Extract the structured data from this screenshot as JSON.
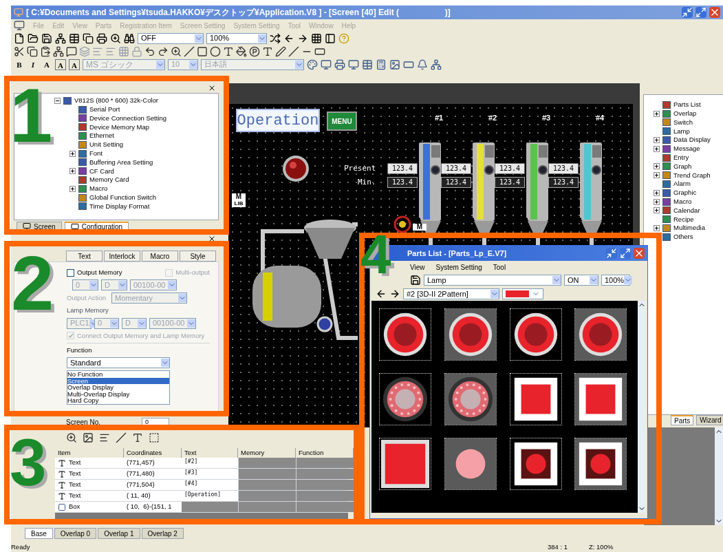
{
  "window": {
    "title": "[ C:¥Documents and Settings¥tsuda.HAKKO¥デスクトップ¥Application.V8 ] - [Screen [40] Edit (                    )]"
  },
  "menu": [
    {
      "label": "File",
      "disabled": true
    },
    {
      "label": "Edit",
      "disabled": true
    },
    {
      "label": "View",
      "disabled": true
    },
    {
      "label": "Parts",
      "disabled": true
    },
    {
      "label": "Registration Item",
      "disabled": true
    },
    {
      "label": "Screen Setting",
      "disabled": true
    },
    {
      "label": "System Setting",
      "disabled": true
    },
    {
      "label": "Tool",
      "disabled": true
    },
    {
      "label": "Window",
      "disabled": true
    },
    {
      "label": "Help",
      "disabled": true
    }
  ],
  "toolbar": {
    "display_state": "OFF",
    "zoom": "100%",
    "format_buttons": [
      "B",
      "I",
      "A",
      "A",
      "A"
    ],
    "font": {
      "value": "MS ゴシック",
      "disabled": true
    },
    "font_size": {
      "value": "10",
      "disabled": true
    },
    "language": {
      "value": "日本語",
      "disabled": true
    }
  },
  "configuration_panel": {
    "tree": [
      {
        "label": "V812S (800 * 600) 32k-Color",
        "expanded": true,
        "children": [
          {
            "label": "Serial Port"
          },
          {
            "label": "Device Connection Setting"
          },
          {
            "label": "Device Memory Map"
          },
          {
            "label": "Ethernet"
          },
          {
            "label": "Unit Setting"
          },
          {
            "label": "Font",
            "expanded": false
          },
          {
            "label": "Buffering Area Setting"
          },
          {
            "label": "CF Card",
            "expanded": false
          },
          {
            "label": "Memory Card"
          },
          {
            "label": "Macro",
            "expanded": false
          },
          {
            "label": "Global Function Switch"
          },
          {
            "label": "Time Display Format"
          }
        ]
      }
    ],
    "tabs": [
      {
        "label": "Screen",
        "selected": false
      },
      {
        "label": "Configuration",
        "selected": true
      }
    ]
  },
  "properties_panel": {
    "tabs": [
      {
        "label": "Text",
        "selected": false
      },
      {
        "label": "Interlock",
        "selected": false
      },
      {
        "label": "Macro",
        "selected": false
      },
      {
        "label": "Style",
        "selected": false
      }
    ],
    "output_memory": {
      "label": "Output Memory",
      "checked": false,
      "disabled": false
    },
    "multi_output": {
      "label": "Multi-output",
      "checked": false,
      "disabled": true
    },
    "output_address": [
      "0",
      "D",
      "00100-00"
    ],
    "output_action": {
      "label": "Output Action",
      "value": "Momentary"
    },
    "lamp_memory": {
      "label": "Lamp Memory",
      "address": [
        "PLC1",
        "0",
        "D",
        "00100-00"
      ]
    },
    "connect": {
      "label": "Connect Output Memory and Lamp Memory",
      "checked": true,
      "disabled": true
    },
    "function": {
      "label": "Function",
      "value": "Standard",
      "options": [
        {
          "label": "No Function",
          "selected": false
        },
        {
          "label": "Screen",
          "selected": true
        },
        {
          "label": "Overlap Display",
          "selected": false
        },
        {
          "label": "Multi-Overlap Display",
          "selected": false
        },
        {
          "label": "Hard Copy",
          "selected": false
        }
      ]
    },
    "screen_no": {
      "label": "Screen No.",
      "value": "0"
    }
  },
  "canvas": {
    "title": "Operation",
    "menu_button": "MENU",
    "present_label": "Present",
    "min_label": "Min.",
    "tanks": [
      {
        "label": "#1",
        "color": "#3f6fd8",
        "present": "123.4",
        "min": "123.4"
      },
      {
        "label": "#2",
        "color": "#e6de3a",
        "present": "123.4",
        "min": "123.4"
      },
      {
        "label": "#3",
        "color": "#5cc24f",
        "present": "123.4",
        "min": "123.4"
      },
      {
        "label": "#4",
        "color": "#4cc8d2",
        "present": "123.4",
        "min": "123.4"
      }
    ],
    "library_badges": [
      {
        "mark": "M",
        "label": "LIB"
      },
      {
        "mark": "M"
      }
    ]
  },
  "parts_panel": {
    "items": [
      {
        "label": "Parts List"
      },
      {
        "label": "Overlap",
        "expanded": false
      },
      {
        "label": "Switch"
      },
      {
        "label": "Lamp"
      },
      {
        "label": "Data Display",
        "expanded": false
      },
      {
        "label": "Message",
        "expanded": false
      },
      {
        "label": "Entry"
      },
      {
        "label": "Graph",
        "expanded": false
      },
      {
        "label": "Trend Graph",
        "expanded": false
      },
      {
        "label": "Alarm"
      },
      {
        "label": "Graphic",
        "expanded": false
      },
      {
        "label": "Macro",
        "expanded": false
      },
      {
        "label": "Calendar",
        "expanded": false
      },
      {
        "label": "Recipe"
      },
      {
        "label": "Multimedia",
        "expanded": false
      },
      {
        "label": "Others"
      }
    ],
    "tabs": [
      {
        "label": "Parts",
        "selected": true
      },
      {
        "label": "Wizard",
        "selected": false
      }
    ]
  },
  "item_list": {
    "columns": [
      "Item",
      "Coordinates",
      "Text",
      "Memory",
      "Function"
    ],
    "rows": [
      {
        "kind": "text",
        "item": "Text",
        "coordinates": "(771,457)",
        "text": "[#2]"
      },
      {
        "kind": "text",
        "item": "Text",
        "coordinates": "(771,480)",
        "text": "[#3]"
      },
      {
        "kind": "text",
        "item": "Text",
        "coordinates": "(771,504)",
        "text": "[#4]"
      },
      {
        "kind": "text",
        "item": "Text",
        "coordinates": "( 11, 40)",
        "text": "[Operation]"
      },
      {
        "kind": "box",
        "item": "Box",
        "coordinates": "( 10,  6)-(151, 1"
      }
    ]
  },
  "parts_window": {
    "title": "Parts List - [Parts_Lp_E.V7]",
    "menu": [
      "View",
      "System Setting",
      "Tool"
    ],
    "category": "Lamp",
    "state": "ON",
    "zoom": "100%",
    "pattern": "#2 [3D-II 2Pattern]",
    "parts": [
      {
        "kind": "ring",
        "framed": false
      },
      {
        "kind": "ring",
        "framed": true
      },
      {
        "kind": "ring",
        "framed": false
      },
      {
        "kind": "ring",
        "framed": true
      },
      {
        "kind": "led-ring",
        "framed": false
      },
      {
        "kind": "led-ring",
        "framed": true
      },
      {
        "kind": "square",
        "framed": false
      },
      {
        "kind": "square",
        "framed": true
      },
      {
        "kind": "flat-square",
        "framed": false
      },
      {
        "kind": "soft-circle",
        "framed": true
      },
      {
        "kind": "glow-square",
        "framed": false
      },
      {
        "kind": "glow-square",
        "framed": true
      }
    ]
  },
  "layer_tabs": [
    {
      "label": "Base",
      "selected": true
    },
    {
      "label": "Overlap 0",
      "selected": false
    },
    {
      "label": "Overlap 1",
      "selected": false
    },
    {
      "label": "Overlap 2",
      "selected": false
    }
  ],
  "status_bar": {
    "message": "Ready",
    "position": "384 : 1",
    "zoom": "Z: 100%"
  },
  "callouts": [
    {
      "number": "1"
    },
    {
      "number": "2"
    },
    {
      "number": "3"
    },
    {
      "number": "4"
    }
  ]
}
